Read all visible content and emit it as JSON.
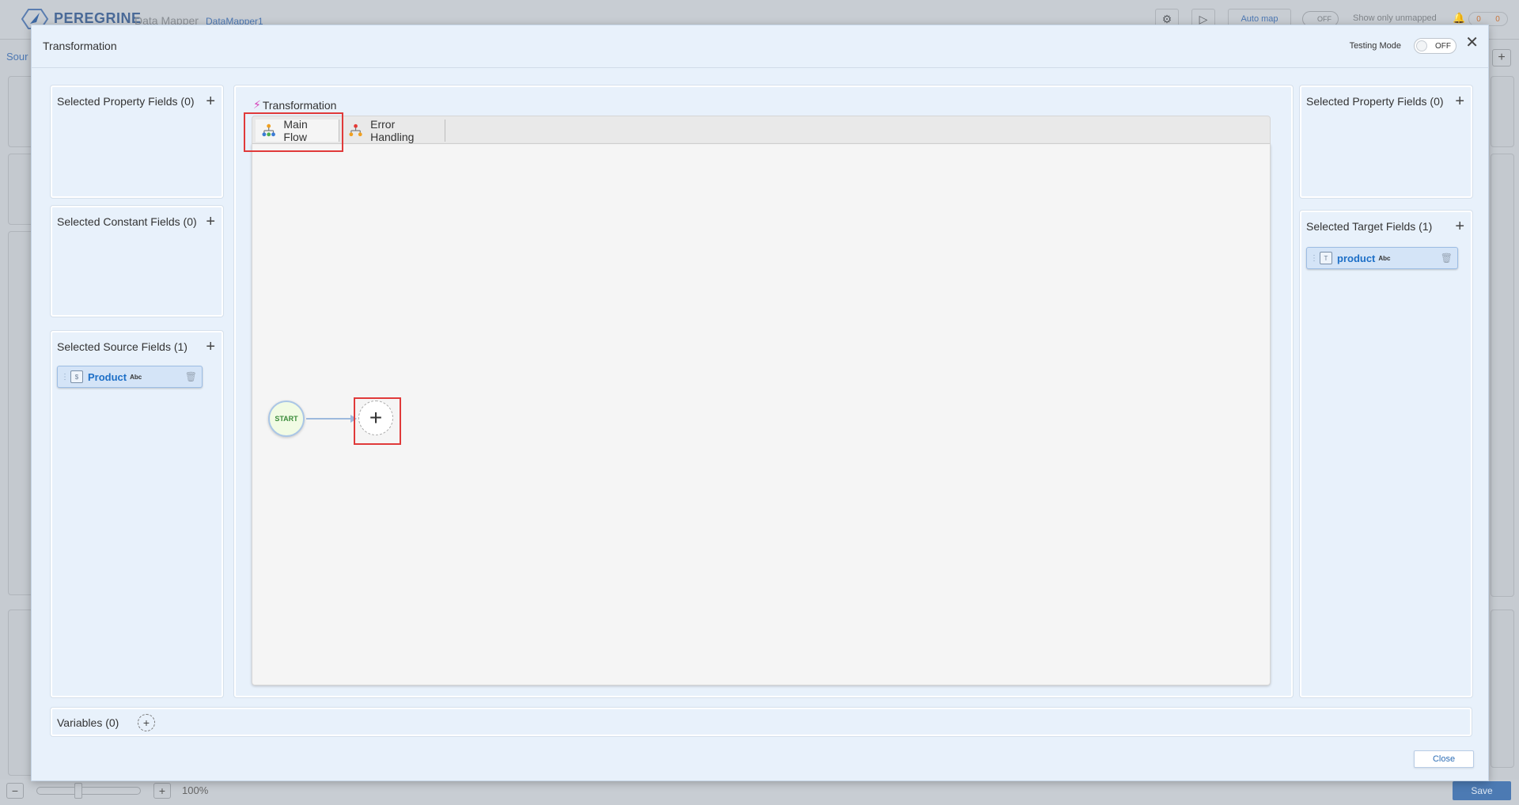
{
  "background": {
    "brand": "PEREGRINE",
    "app_name": "Data Mapper",
    "mapper_name": "DataMapper1",
    "auto_map_label": "Auto map",
    "toggle_label": "OFF",
    "show_unmapped_label": "Show only unmapped",
    "counter_a": "0",
    "counter_b": "0",
    "source_label": "Sour",
    "zoom_level": "100%",
    "save_label": "Save",
    "icons": [
      "settings-gear-icon",
      "play-icon",
      "bell-icon",
      "plus-icon",
      "minus-icon"
    ]
  },
  "modal": {
    "title": "Transformation",
    "testing_mode_label": "Testing Mode",
    "testing_mode_value": "OFF",
    "close_label": "Close"
  },
  "left_panels": {
    "property": {
      "title": "Selected Property Fields (0)"
    },
    "constant": {
      "title": "Selected Constant Fields (0)"
    },
    "source": {
      "title": "Selected Source Fields (1)",
      "fields": [
        {
          "name": "Product",
          "type": "Abc"
        }
      ]
    }
  },
  "right_panels": {
    "property": {
      "title": "Selected Property Fields (0)"
    },
    "target": {
      "title": "Selected Target Fields (1)",
      "fields": [
        {
          "name": "product",
          "type": "Abc"
        }
      ]
    }
  },
  "transformation": {
    "title": "Transformation",
    "tabs": [
      {
        "label": "Main Flow",
        "active": true,
        "icon": "hierarchy-icon"
      },
      {
        "label": "Error Handling",
        "active": false,
        "icon": "error-hierarchy-icon"
      }
    ],
    "start_node_label": "START"
  },
  "variables": {
    "label": "Variables (0)"
  },
  "colors": {
    "modal_bg": "#e8f1fb",
    "accent_blue": "#1d6fc7",
    "highlight_red": "#e03a3a",
    "start_green": "#3a8b3a",
    "bolt_magenta": "#d63fb8"
  }
}
